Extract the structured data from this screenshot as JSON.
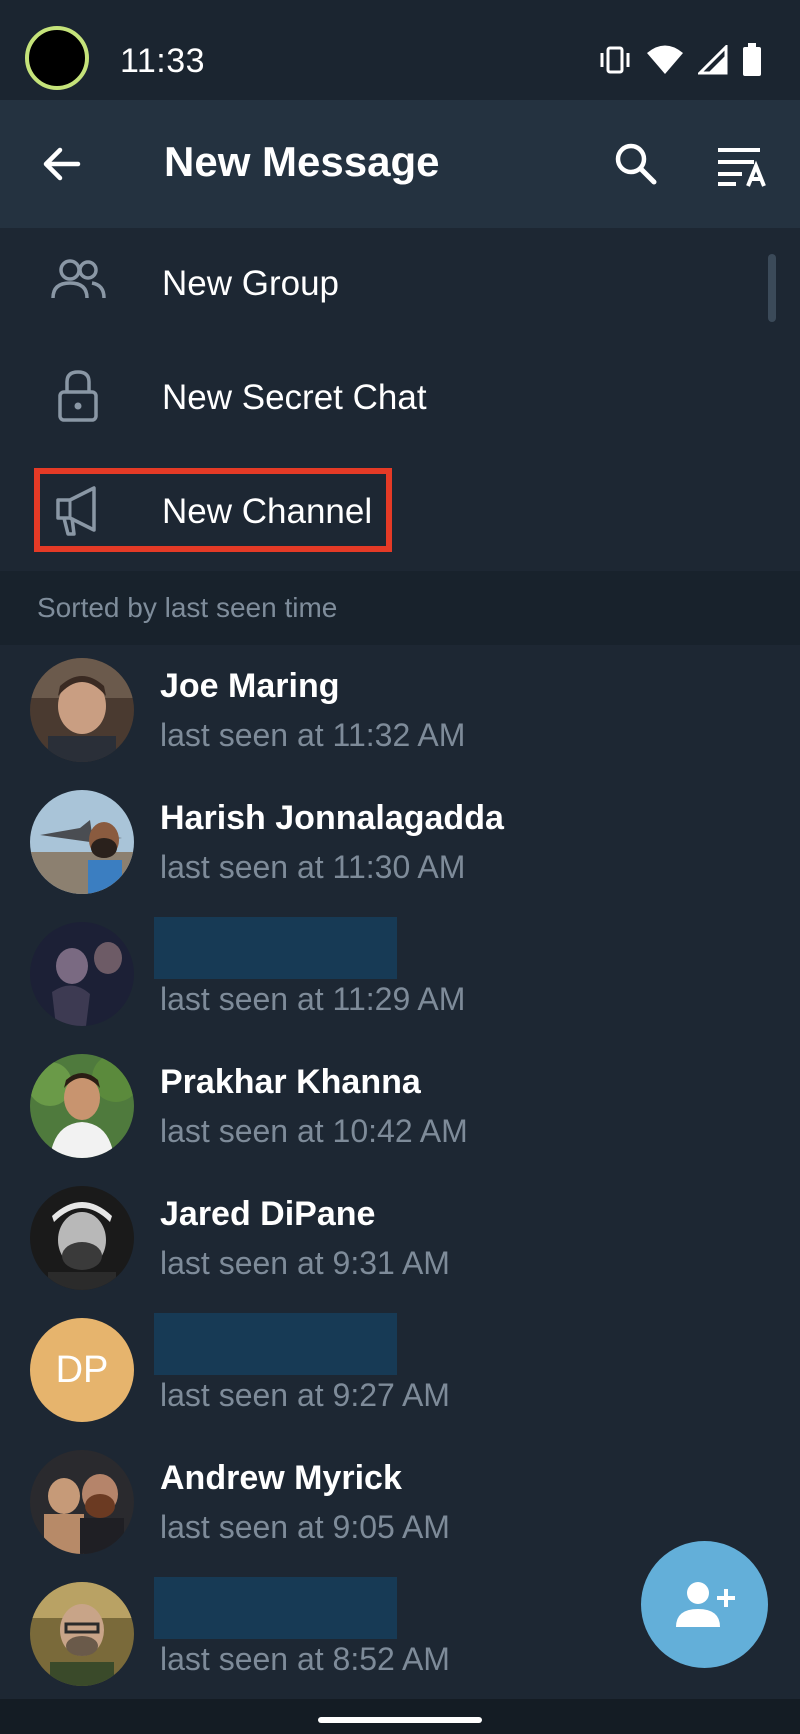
{
  "status_bar": {
    "time": "11:33",
    "icons": [
      "vibrate-icon",
      "wifi-icon",
      "signal-icon",
      "battery-icon"
    ]
  },
  "toolbar": {
    "title": "New Message",
    "back_icon": "arrow-back-icon",
    "search_icon": "search-icon",
    "sort_icon": "sort-az-icon"
  },
  "menu": [
    {
      "label": "New Group",
      "icon": "group-icon"
    },
    {
      "label": "New Secret Chat",
      "icon": "lock-icon"
    },
    {
      "label": "New Channel",
      "icon": "megaphone-icon",
      "highlighted": true
    }
  ],
  "section_header": "Sorted by last seen time",
  "contacts": [
    {
      "name": "Joe Maring",
      "status": "last seen at 11:32 AM",
      "avatar": "photo"
    },
    {
      "name": "Harish Jonnalagadda",
      "status": "last seen at 11:30 AM",
      "avatar": "photo"
    },
    {
      "name": "",
      "status": "last seen at 11:29 AM",
      "avatar": "photo",
      "redacted": true
    },
    {
      "name": "Prakhar Khanna",
      "status": "last seen at 10:42 AM",
      "avatar": "photo"
    },
    {
      "name": "Jared DiPane",
      "status": "last seen at 9:31 AM",
      "avatar": "photo"
    },
    {
      "name": "",
      "status": "last seen at 9:27 AM",
      "avatar_initials": "DP",
      "redacted": true
    },
    {
      "name": "Andrew Myrick",
      "status": "last seen at 9:05 AM",
      "avatar": "photo"
    },
    {
      "name": "",
      "status": "last seen at 8:52 AM",
      "avatar": "photo",
      "redacted": true
    }
  ],
  "fab_icon": "add-contact-icon",
  "colors": {
    "background": "#1d2733",
    "toolbar": "#243240",
    "highlight": "#e53a26",
    "fab": "#63afd9",
    "secondary_text": "#7e8b99"
  }
}
